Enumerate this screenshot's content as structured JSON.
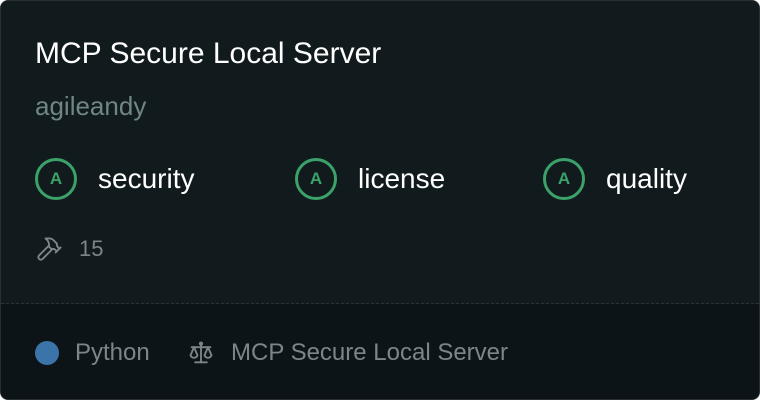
{
  "card": {
    "title": "MCP Secure Local Server",
    "author": "agileandy",
    "grades": [
      {
        "grade": "A",
        "label": "security"
      },
      {
        "grade": "A",
        "label": "license"
      },
      {
        "grade": "A",
        "label": "quality"
      }
    ],
    "tools": {
      "icon": "hammer-icon",
      "count": "15"
    },
    "footer": {
      "language": {
        "name": "Python",
        "color": "#3b74a8"
      },
      "license": {
        "icon": "scale-icon",
        "name": "MCP Secure Local Server"
      }
    }
  },
  "colors": {
    "background": "#111a1d",
    "footer_background": "#0d1417",
    "grade_green": "#3ba169",
    "muted_text": "#7d8589",
    "author_text": "#6f8784"
  }
}
